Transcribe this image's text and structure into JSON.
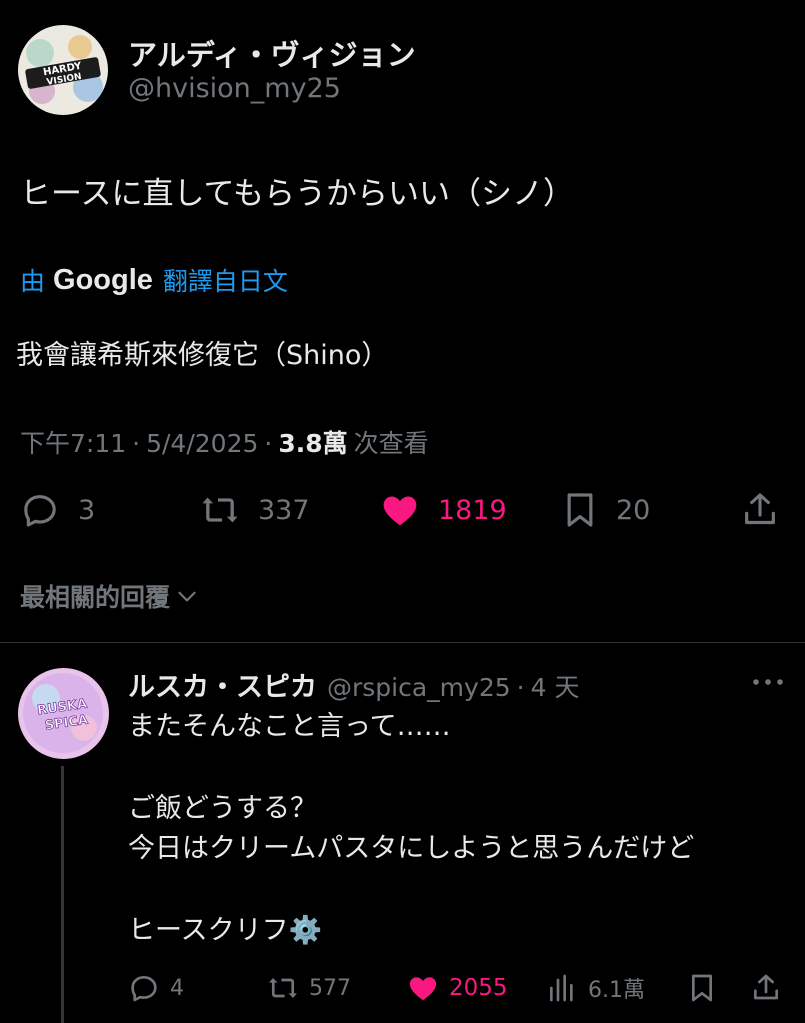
{
  "tweet": {
    "author": {
      "display_name": "アルディ・ヴィジョン",
      "handle": "@hvision_my25",
      "avatar_text_1": "HARDY",
      "avatar_text_2": "VISION"
    },
    "text": "ヒースに直してもらうからいい（シノ）",
    "translation": {
      "prefix": "由",
      "provider": "Google",
      "suffix": "翻譯自日文",
      "text": "我會讓希斯來修復它（Shino）"
    },
    "meta": {
      "time": "下午7:11",
      "sep1": "·",
      "date": "5/4/2025",
      "sep2": "·",
      "views": "3.8萬",
      "views_label": "次查看"
    },
    "actions": {
      "replies": "3",
      "retweets": "337",
      "likes": "1819",
      "bookmarks": "20"
    }
  },
  "sort": {
    "label": "最相關的回覆"
  },
  "reply": {
    "author": {
      "display_name": "ルスカ・スピカ",
      "handle": "@rspica_my25",
      "sep": "·",
      "time": "4 天",
      "avatar_text_1": "RUSKA",
      "avatar_text_2": "SPICA"
    },
    "lines": [
      "またそんなこと言って……",
      "ご飯どうする？",
      "今日はクリームパスタにしようと思うんだけど",
      "ヒースクリフ⚙️"
    ],
    "actions": {
      "replies": "4",
      "retweets": "577",
      "likes": "2055",
      "views": "6.1萬"
    }
  },
  "colors": {
    "like": "#f91880",
    "link": "#1d9bf0",
    "muted": "#71767b",
    "text": "#e7e9ea"
  }
}
